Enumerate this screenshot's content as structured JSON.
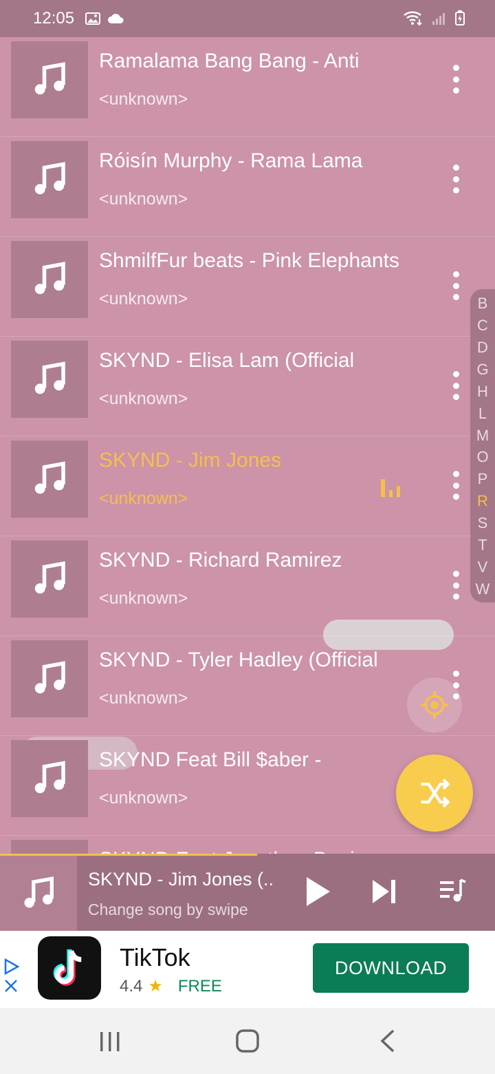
{
  "status_bar": {
    "time": "12:05",
    "icons": [
      "image-icon",
      "cloud-icon",
      "wifi-icon",
      "signal-icon",
      "battery-icon"
    ]
  },
  "songs": [
    {
      "title": "Ramalama Bang Bang - Anti",
      "artist": "<unknown>",
      "playing": false
    },
    {
      "title": "Róisín Murphy - Rama Lama",
      "artist": "<unknown>",
      "playing": false
    },
    {
      "title": "ShmilfFur beats - Pink Elephants",
      "artist": "<unknown>",
      "playing": false
    },
    {
      "title": "SKYND - Elisa Lam (Official",
      "artist": "<unknown>",
      "playing": false
    },
    {
      "title": "SKYND - Jim Jones",
      "artist": "<unknown>",
      "playing": true
    },
    {
      "title": "SKYND - Richard Ramirez",
      "artist": "<unknown>",
      "playing": false
    },
    {
      "title": "SKYND - Tyler Hadley (Official",
      "artist": "<unknown>",
      "playing": false
    },
    {
      "title": "SKYND Feat Bill $aber -",
      "artist": "<unknown>",
      "playing": false
    },
    {
      "title": "SKYND Feat Jonathan Davis",
      "artist": "",
      "playing": false
    }
  ],
  "alphabet_index": {
    "letters": [
      "B",
      "C",
      "D",
      "G",
      "H",
      "L",
      "M",
      "O",
      "P",
      "R",
      "S",
      "T",
      "V",
      "W"
    ],
    "active": "R"
  },
  "mini_player": {
    "title": "SKYND - Jim Jones (..",
    "subtitle": "Change song by swipe",
    "progress": 0.52
  },
  "ad": {
    "app_name": "TikTok",
    "rating": "4.4",
    "price": "FREE",
    "button_label": "DOWNLOAD"
  },
  "colors": {
    "background": "#cc93a9",
    "status_bar": "#a47689",
    "accent": "#f5c04a",
    "shuffle_fab": "#f8cd4e",
    "download_button": "#0b7c55"
  }
}
